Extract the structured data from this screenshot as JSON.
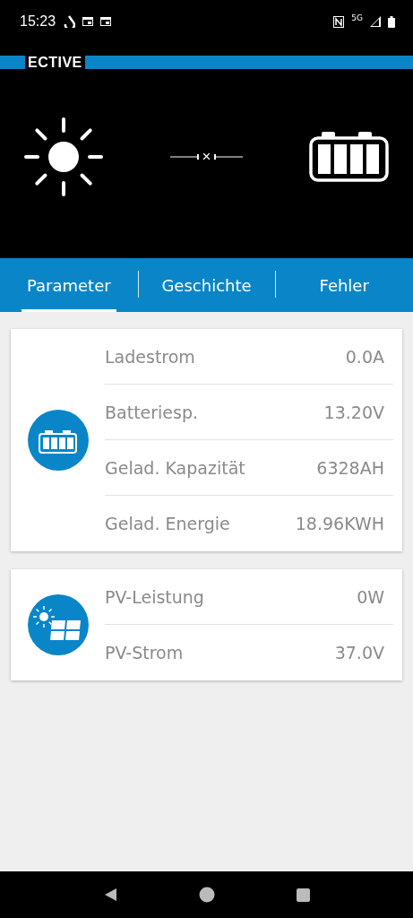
{
  "status_bar": {
    "time": "15:23",
    "network": "5G"
  },
  "logo": {
    "text": "ECTIVE"
  },
  "connection": {
    "symbol": "×"
  },
  "tabs": [
    {
      "label": "Parameter",
      "selected": true
    },
    {
      "label": "Geschichte",
      "selected": false
    },
    {
      "label": "Fehler",
      "selected": false
    }
  ],
  "cards": [
    {
      "kind": "battery",
      "rows": [
        {
          "label": "Ladestrom",
          "value": "0.0A"
        },
        {
          "label": "Batteriesp.",
          "value": "13.20V"
        },
        {
          "label": "Gelad. Kapazität",
          "value": "6328AH"
        },
        {
          "label": "Gelad. Energie",
          "value": "18.96KWH"
        }
      ]
    },
    {
      "kind": "solar",
      "rows": [
        {
          "label": "PV-Leistung",
          "value": "0W"
        },
        {
          "label": "PV-Strom",
          "value": "37.0V"
        }
      ]
    }
  ]
}
